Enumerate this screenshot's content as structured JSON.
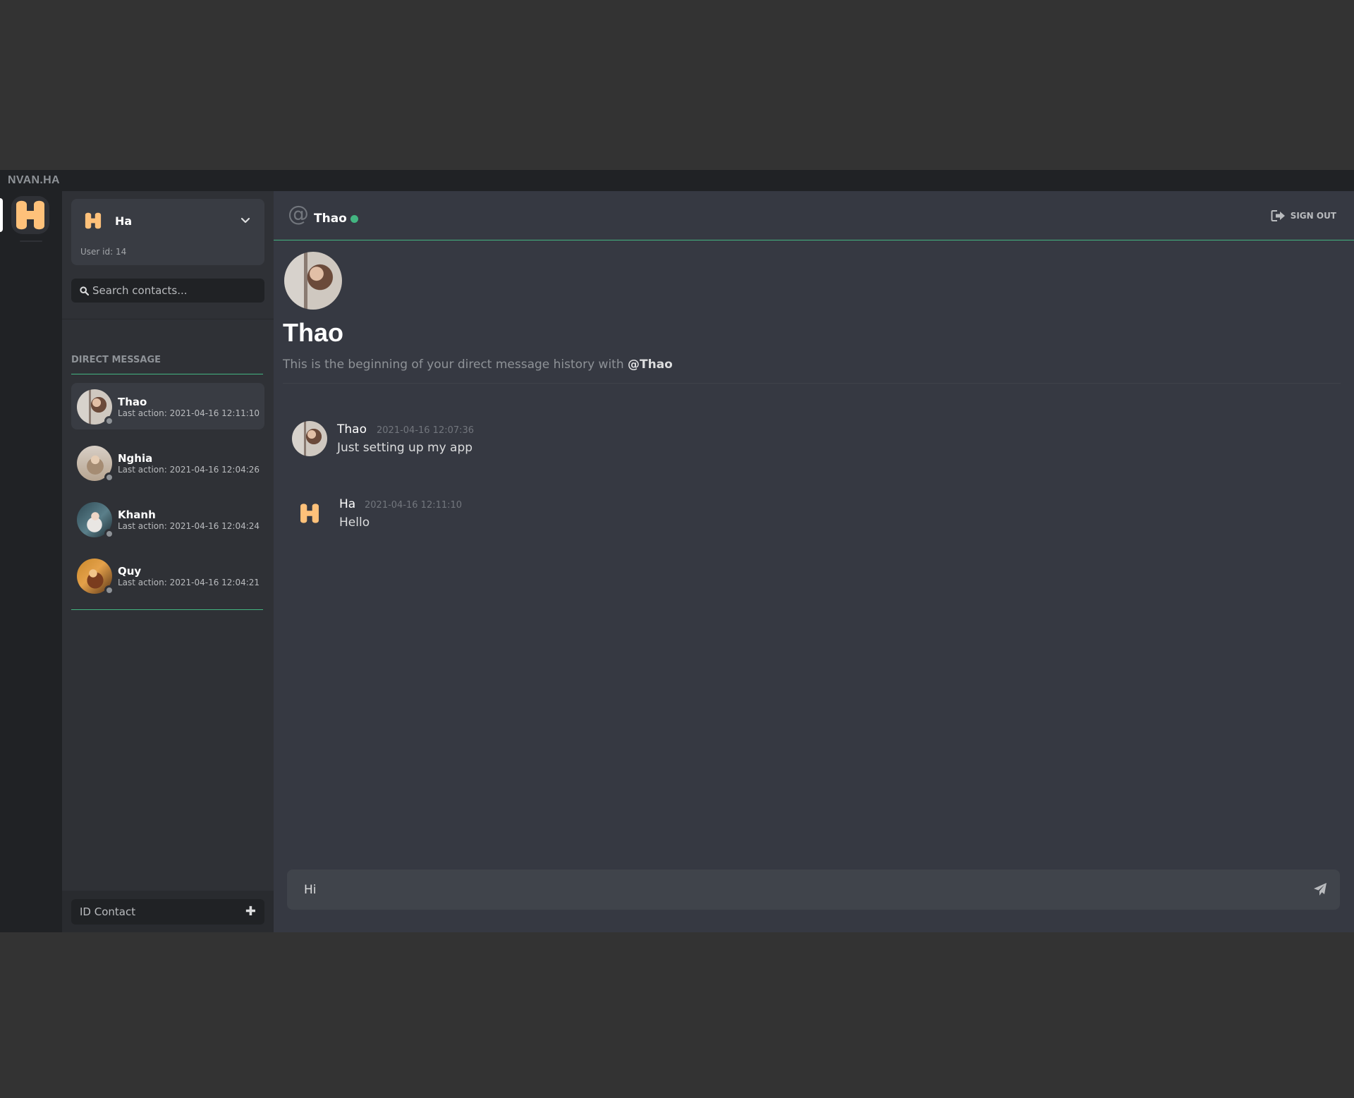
{
  "brand": "NVAN.HA",
  "colors": {
    "accent": "#43b581",
    "logo": "#fec17a",
    "bg_main": "#363942",
    "bg_side": "#2f3136",
    "bg_rail": "#202225"
  },
  "current_user": {
    "name": "Ha",
    "user_id_label": "User id: 14",
    "logo_icon": "h-logo-icon"
  },
  "search": {
    "placeholder": "Search contacts..."
  },
  "direct_message": {
    "heading": "DIRECT MESSAGE",
    "contacts": [
      {
        "name": "Thao",
        "last_action": "Last action: 2021-04-16 12:11:10",
        "active": true,
        "status": "offline"
      },
      {
        "name": "Nghia",
        "last_action": "Last action: 2021-04-16 12:04:26",
        "active": false,
        "status": "offline"
      },
      {
        "name": "Khanh",
        "last_action": "Last action: 2021-04-16 12:04:24",
        "active": false,
        "status": "offline"
      },
      {
        "name": "Quy",
        "last_action": "Last action: 2021-04-16 12:04:21",
        "active": false,
        "status": "offline"
      }
    ]
  },
  "add_contact": {
    "placeholder": "ID Contact",
    "button_icon": "plus-icon"
  },
  "chat": {
    "header": {
      "at_symbol": "@",
      "name": "Thao",
      "status": "online"
    },
    "sign_out_label": "SIGN OUT",
    "intro": {
      "name": "Thao",
      "text_prefix": "This is the beginning of your direct message history with ",
      "mention": "@Thao"
    },
    "messages": [
      {
        "author": "Thao",
        "time": "2021-04-16 12:07:36",
        "text": "Just setting up my app"
      },
      {
        "author": "Ha",
        "time": "2021-04-16 12:11:10",
        "text": "Hello"
      }
    ],
    "composer": {
      "value": "Hi",
      "send_icon": "paper-plane-icon"
    }
  }
}
